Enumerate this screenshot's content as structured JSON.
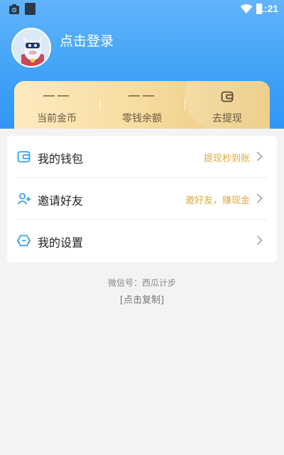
{
  "status_bar": {
    "time": "1:21"
  },
  "profile": {
    "login_text": "点击登录"
  },
  "stats": [
    {
      "value": "——",
      "label": "当前金币"
    },
    {
      "value": "——",
      "label": "零钱余额"
    },
    {
      "value": "",
      "label": "去提现"
    }
  ],
  "menu": [
    {
      "label": "我的钱包",
      "hint": "提现秒到账",
      "icon": "wallet-icon"
    },
    {
      "label": "邀请好友",
      "hint": "邀好友，赚现金",
      "icon": "add-user-icon"
    },
    {
      "label": "我的设置",
      "hint": "",
      "icon": "settings-icon"
    }
  ],
  "footer": {
    "wechat": "微信号：西瓜计步",
    "copy": "[点击复制]"
  },
  "colors": {
    "header_blue": "#41a3f7",
    "gold_text": "#e0a93a",
    "card_gold": "#f6dc9f"
  }
}
